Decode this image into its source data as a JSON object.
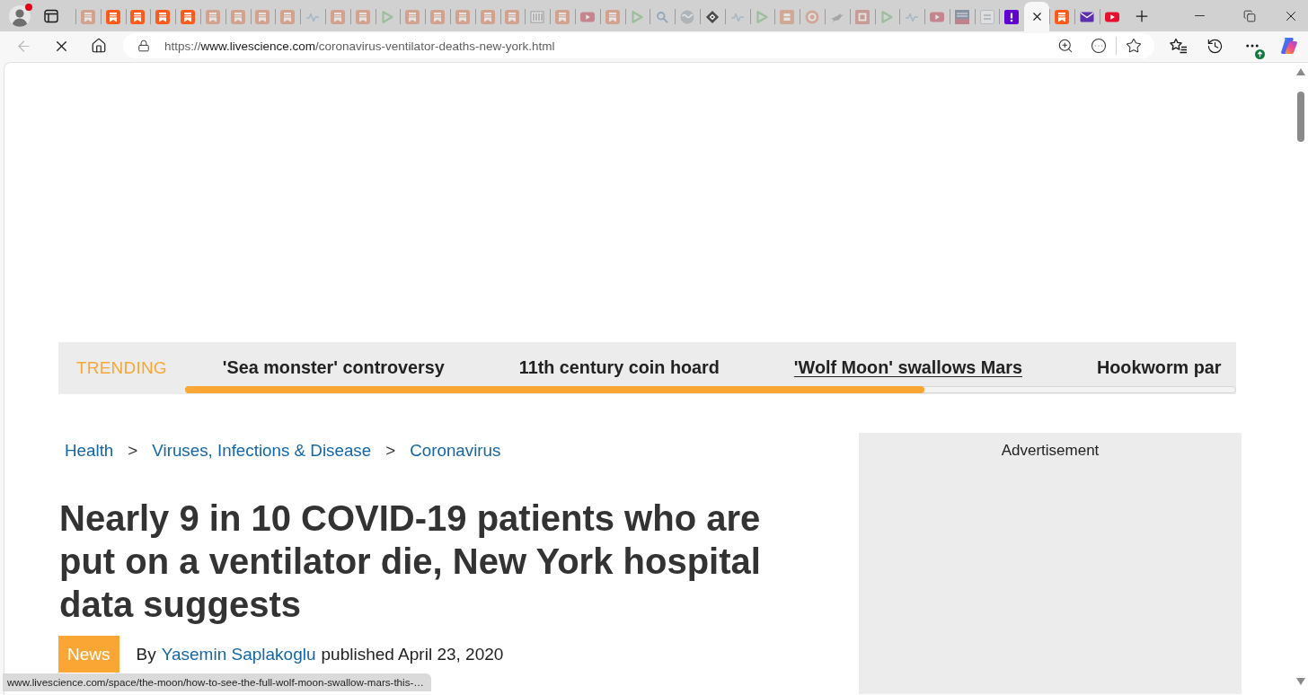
{
  "browser": {
    "profile": {
      "notification": true
    },
    "tabs": [
      {
        "kind": "bookmark",
        "faded": true,
        "selected": false
      },
      {
        "kind": "bookmark",
        "faded": false,
        "selected": false
      },
      {
        "kind": "bookmark",
        "faded": false,
        "selected": false
      },
      {
        "kind": "bookmark",
        "faded": false,
        "selected": false
      },
      {
        "kind": "bookmark",
        "faded": false,
        "selected": false
      },
      {
        "kind": "bookmark",
        "faded": true,
        "selected": false
      },
      {
        "kind": "bookmark",
        "faded": true,
        "selected": false
      },
      {
        "kind": "bookmark",
        "faded": true,
        "selected": false
      },
      {
        "kind": "bookmark",
        "faded": true,
        "selected": false
      },
      {
        "kind": "heartbeat",
        "faded": true,
        "selected": false
      },
      {
        "kind": "bookmark",
        "faded": true,
        "selected": false
      },
      {
        "kind": "bookmark",
        "faded": true,
        "selected": false
      },
      {
        "kind": "play",
        "faded": true,
        "selected": false
      },
      {
        "kind": "bookmark",
        "faded": true,
        "selected": false
      },
      {
        "kind": "bookmark",
        "faded": true,
        "selected": false
      },
      {
        "kind": "bookmark",
        "faded": true,
        "selected": false
      },
      {
        "kind": "bookmark",
        "faded": true,
        "selected": false
      },
      {
        "kind": "bookmark",
        "faded": true,
        "selected": false
      },
      {
        "kind": "striped",
        "faded": true,
        "selected": false
      },
      {
        "kind": "bookmark",
        "faded": true,
        "selected": false
      },
      {
        "kind": "video",
        "faded": true,
        "selected": false
      },
      {
        "kind": "bookmark",
        "faded": true,
        "selected": false
      },
      {
        "kind": "play",
        "faded": true,
        "selected": false
      },
      {
        "kind": "search",
        "faded": true,
        "selected": false
      },
      {
        "kind": "globe",
        "faded": true,
        "selected": false
      },
      {
        "kind": "diamond",
        "faded": false,
        "selected": false
      },
      {
        "kind": "heartbeat",
        "faded": true,
        "selected": false
      },
      {
        "kind": "play",
        "faded": true,
        "selected": false
      },
      {
        "kind": "tile",
        "faded": true,
        "selected": false
      },
      {
        "kind": "ring",
        "faded": true,
        "selected": false
      },
      {
        "kind": "bird",
        "faded": true,
        "selected": false
      },
      {
        "kind": "square",
        "faded": true,
        "selected": false
      },
      {
        "kind": "play",
        "faded": true,
        "selected": false
      },
      {
        "kind": "heartbeat",
        "faded": true,
        "selected": false
      },
      {
        "kind": "video",
        "faded": true,
        "selected": false
      },
      {
        "kind": "news",
        "faded": true,
        "selected": false
      },
      {
        "kind": "framed",
        "faded": true,
        "selected": false
      },
      {
        "kind": "exclaim",
        "faded": false,
        "selected": false
      },
      {
        "kind": "blank",
        "faded": false,
        "selected": true
      },
      {
        "kind": "bookmark",
        "faded": false,
        "selected": false
      },
      {
        "kind": "mail",
        "faded": false,
        "selected": false
      },
      {
        "kind": "video",
        "faded": false,
        "selected": false
      }
    ],
    "toolbar": {
      "back_disabled": true,
      "loading": true,
      "url": {
        "scheme": "https://",
        "host": "www.livescience.com",
        "path": "/coronavirus-ventilator-deaths-new-york.html"
      },
      "menu_update": true
    }
  },
  "page": {
    "trending": {
      "label": "TRENDING",
      "items": [
        {
          "text": "'Sea monster' controversy",
          "hovered": false
        },
        {
          "text": "11th century coin hoard",
          "hovered": false
        },
        {
          "text": "'Wolf Moon' swallows Mars",
          "hovered": true
        },
        {
          "text": "Hookworm par",
          "hovered": false
        }
      ],
      "level": 0.704
    },
    "breadcrumbs": [
      {
        "kind": "link",
        "text": "Health"
      },
      {
        "kind": "separator",
        "text": ">"
      },
      {
        "kind": "link",
        "text": "Viruses, Infections & Disease"
      },
      {
        "kind": "separator",
        "text": ">"
      },
      {
        "kind": "link",
        "text": "Coronavirus"
      }
    ],
    "headline": "Nearly 9 in 10 COVID-19 patients who are put on a ventilator die, New York hospital data suggests",
    "article_type": "News",
    "byline": {
      "prefix": "By",
      "author": "Yasemin Saplakoglu",
      "date": "published April 23, 2020"
    },
    "sidebar": {
      "ad_label": "Advertisement"
    },
    "status_url": "www.livescience.com/space/the-moon/how-to-see-the-full-wolf-moon-swallow-mars-this-…"
  }
}
